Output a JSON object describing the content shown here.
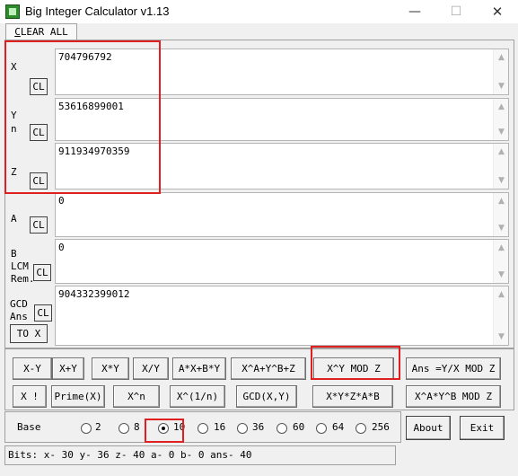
{
  "window": {
    "title": "Big Integer Calculator v1.13",
    "minimize_glyph": "—",
    "maximize_glyph": "☐",
    "close_glyph": "✕"
  },
  "clear_all": {
    "prefix": "C",
    "rest": "LEAR ALL"
  },
  "fields": {
    "x": {
      "label": "X",
      "value": "704796792",
      "cl": "CL"
    },
    "y": {
      "label_line1": "Y",
      "label_line2": "n",
      "value": "53616899001",
      "cl": "CL"
    },
    "z": {
      "label": "Z",
      "value": "911934970359",
      "cl": "CL"
    },
    "a": {
      "label": "A",
      "value": "0",
      "cl": "CL"
    },
    "b": {
      "label_line1": "B",
      "label_line2": "LCM",
      "label_line3": "Rem.",
      "value": "0",
      "cl": "CL"
    },
    "gcd": {
      "label_line1": "GCD",
      "label_line2": "Ans",
      "value": "904332399012",
      "cl": "CL",
      "to_x": "TO X"
    }
  },
  "scroll": {
    "up": "▲",
    "down": "▼"
  },
  "buttons_row1": {
    "x_minus_y": "X-Y",
    "x_plus_y": "X+Y",
    "x_times_y": "X*Y",
    "x_div_y": "X/Y",
    "axby": "A*X+B*Y",
    "xa_yb_z": "X^A+Y^B+Z",
    "xy_mod_z": "X^Y MOD Z",
    "ans_yx_mod_z": "Ans =Y/X MOD Z"
  },
  "buttons_row2": {
    "x_fact": "X !",
    "prime": "Prime(X)",
    "x_pow_n": "X^n",
    "x_root_n": "X^(1/n)",
    "gcd": "GCD(X,Y)",
    "xyzab": "X*Y*Z*A*B",
    "xa_yb_mod_z": "X^A*Y^B MOD Z"
  },
  "base": {
    "label": "Base",
    "options": [
      "2",
      "8",
      "10",
      "16",
      "36",
      "60",
      "64",
      "256"
    ],
    "selected": "10"
  },
  "actions": {
    "about": "About",
    "exit": "Exit"
  },
  "status": "Bits: x- 30 y- 36 z- 40 a- 0 b- 0 ans- 40"
}
